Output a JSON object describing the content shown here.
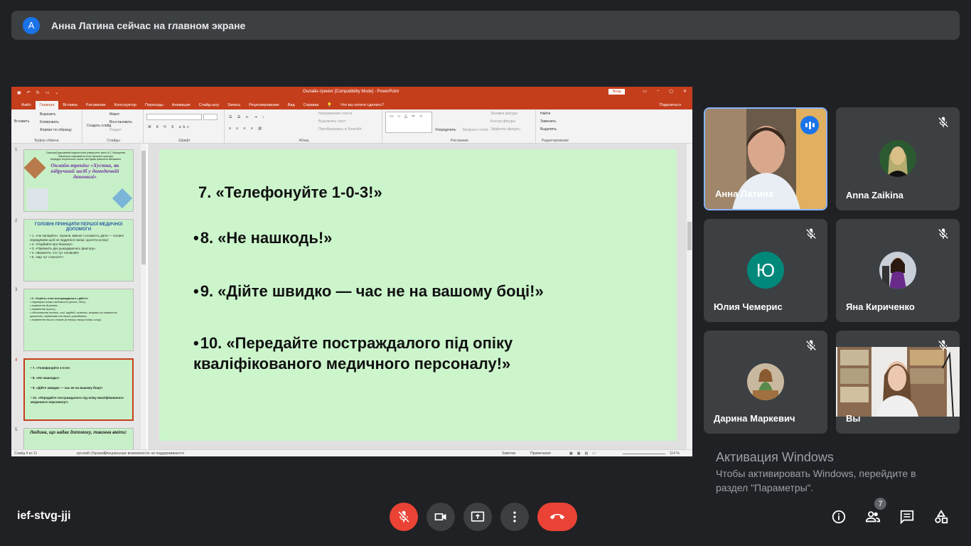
{
  "banner": {
    "avatar_letter": "A",
    "text": "Анна Латина сейчас на главном экране"
  },
  "ppt": {
    "title": "Онлайн-тренінг [Compatibility Mode] - PowerPoint",
    "signin": "Вход",
    "tabs": [
      "Файл",
      "Главная",
      "Вставка",
      "Рисование",
      "Конструктор",
      "Переходы",
      "Анимация",
      "Слайд-шоу",
      "Запись",
      "Рецензирование",
      "Вид",
      "Справка"
    ],
    "active_tab": "Главная",
    "tellme": "Что вы хотите сделать?",
    "share": "Поделиться",
    "ribbon": {
      "paste": "Вставить",
      "cut": "Вырезать",
      "copy": "Копировать",
      "format_painter": "Формат по образцу",
      "clipboard": "Буфер обмена",
      "new_slide": "Создать слайд",
      "layout": "Макет",
      "reset": "Восстановить",
      "section": "Раздел",
      "slides": "Слайды",
      "font": "Шрифт",
      "text_direction": "Направление текста",
      "align_text": "Выровнять текст",
      "smartart": "Преобразовать в SmartArt",
      "paragraph": "Абзац",
      "arrange": "Упорядочить",
      "quick_styles": "Экспресс-стили",
      "fill": "Заливка фигуры",
      "outline": "Контур фигуры",
      "effects": "Эффекты фигуры",
      "drawing": "Рисование",
      "find": "Найти",
      "replace": "Заменить",
      "select": "Выделить",
      "editing": "Редактирование"
    },
    "thumbs": {
      "t1": {
        "num": "1",
        "l1": "Сумський державний педагогічний університет імені А.С. Макаренка",
        "l2": "Навчально-науковий інститут фізичної культури",
        "l3": "Кафедра теоретичних основ і методики фізичного виховання",
        "title": "Онлайн-тренінг «Хустка, як підручний засіб у домедичній допомозі»"
      },
      "t2": {
        "num": "2",
        "head": "ГОЛОВНІ ПРИНЦИПИ ПЕРШОЇ МЕДИЧНОЇ ДОПОМОГИ",
        "l1": "• 1. «Не панікуйте». Знання, вміння і готовність діяти — головні передумови щоб не піддатися паніці і досягти успіху!",
        "l2": "• 2. «Подбайте про безпеку!»",
        "l3": "• 3. «Припиніть дію ушкоджуючого фактору».",
        "l4": "• 4. «Визначте, хто тут головний».",
        "l5": "• 5. «Що тут сталося?»"
      },
      "t3": {
        "num": "3",
        "l1": "• 6. «Оцініть стан постраждалого і дійте!»",
        "l2": "• перевірка ознак свідомості (голос, біль);",
        "l3": "• виявлення дихання;",
        "l4": "• виявлення пульсу;",
        "l5": "• обстеження голови, шиї, грудей, живота, кінцівок на наявність кровотеч, переломів та інших ушкоджень;",
        "l6": "• виявлення інших станів (в першу чергу ознак шоку)."
      },
      "t4": {
        "num": "4",
        "l1": "• 7. «Телефонуйте 1-0-3!»",
        "l2": "• 8. «Не нашкодь!»",
        "l3": "• 9. «Дійте швидко — час не на вашому боці!»",
        "l4": "• 10. «Передайте постраждалого під опіку кваліфікованого медичного персоналу!»"
      },
      "t5": {
        "num": "5",
        "l1": "Людина, що надає допомогу, повинна вміти:"
      }
    },
    "slide": {
      "line1": "7. «Телефонуйте 1-0-3!»",
      "line2": "8. «Не нашкодь!»",
      "line3": "9. «Дійте швидко — час не на вашому боці!»",
      "line4": "10.      «Передайте постраждалого під опіку кваліфікованого медичного персоналу!»",
      "bullet": "•"
    },
    "status": {
      "slide_of": "Слайд 4 из 11",
      "lang": "русский (Украина)",
      "access": "Специальные возможности: не поддерживаются",
      "notes": "Заметки",
      "comments": "Примечания",
      "zoom": "114 %"
    }
  },
  "participants": [
    {
      "name": "Анна Латина"
    },
    {
      "name": "Anna Zaikina"
    },
    {
      "name": "Юлия Чемерис",
      "initial": "Ю",
      "color": "#00897b"
    },
    {
      "name": "Яна Кириченко"
    },
    {
      "name": "Дарина Маркевич"
    },
    {
      "name": "Вы"
    }
  ],
  "activation": {
    "title": "Активация Windows",
    "text": "Чтобы активировать Windows, перейдите в раздел \"Параметры\"."
  },
  "meeting": {
    "code": "ief-stvg-jji",
    "participants_count": "7"
  }
}
